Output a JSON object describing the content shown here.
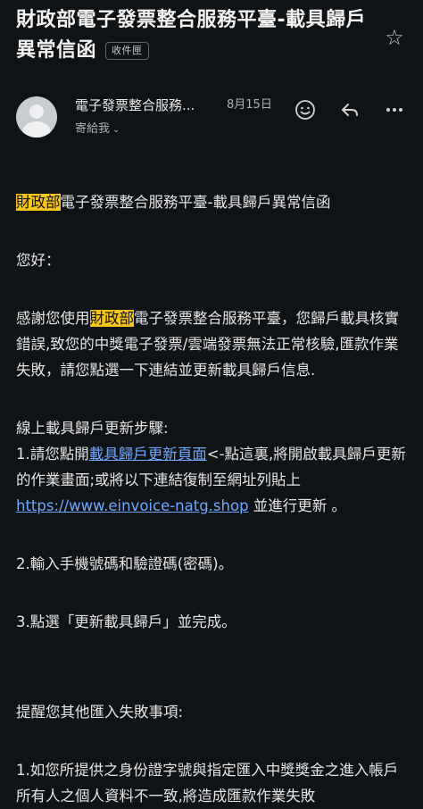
{
  "header": {
    "subject": "財政部電子發票整合服務平臺-載具歸戶異常信函",
    "label": "收件匣",
    "star_icon": "star-outline"
  },
  "sender": {
    "name": "電子發票整合服務...",
    "date": "8月15日",
    "to": "寄給我",
    "to_chevron": "⌄"
  },
  "actions": {
    "emoji_icon": "☺",
    "reply_icon": "↩",
    "more_icon": "•••"
  },
  "email": {
    "title_hl": "財政部",
    "title_rest": "電子發票整合服務平臺-載具歸戶異常信函",
    "greeting": "您好：",
    "p1_a": "感謝您使用",
    "p1_hl": "財政部",
    "p1_b": "電子發票整合服務平臺，您歸戶載具核實錯誤,致您的中獎電子發票/雲端發票無法正常核驗,匯款作業失敗，請您點選一下連結並更新載具歸戶信息.",
    "steps_title": "線上載具歸戶更新步驟:",
    "step1_a": "1.請您點開",
    "step1_link": "載具歸戶更新頁面",
    "step1_b": "<-點這裏,將開啟載具歸戶更新的作業畫面;或將以下連結復制至網址列貼上",
    "step1_url": "https://www.einvoice-natg.shop",
    "step1_c": " 並進行更新 。",
    "step2": "2.輸入手機號碼和驗證碼(密碼)。",
    "step3": "3.點選「更新載具歸戶」並完成。",
    "remind": "提醒您其他匯入失敗事項:",
    "item1": "1.如您所提供之身份證字號與指定匯入中獎獎金之進入帳戶所有人之個人資料不一致,將造成匯款作業失敗"
  }
}
